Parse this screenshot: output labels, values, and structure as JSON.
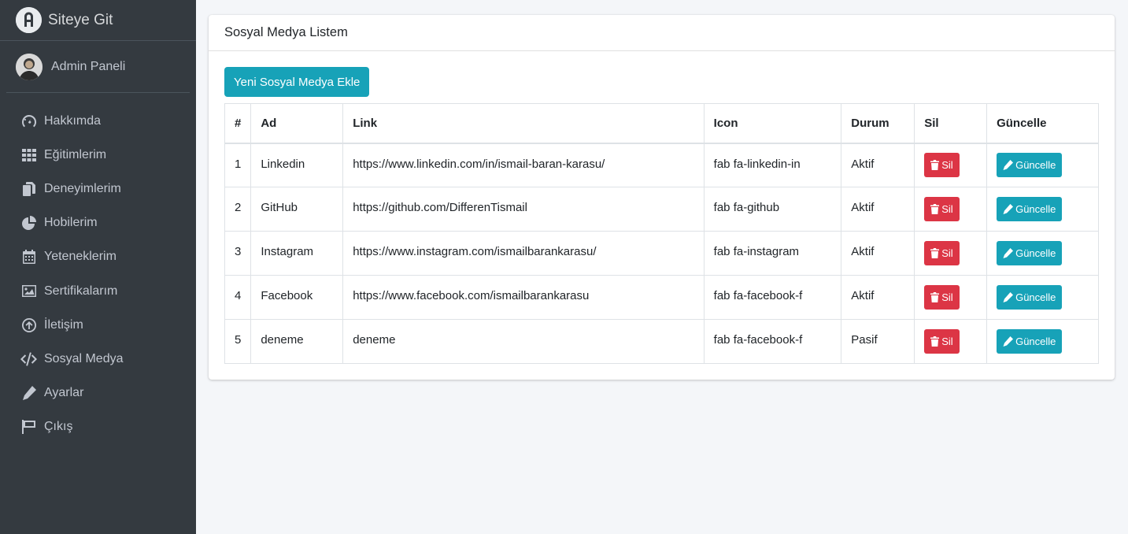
{
  "brand": {
    "title": "Siteye Git"
  },
  "user": {
    "name": "Admin Paneli"
  },
  "sidebar": {
    "items": [
      {
        "label": "Hakkımda",
        "icon": "tachometer-icon"
      },
      {
        "label": "Eğitimlerim",
        "icon": "grid-icon"
      },
      {
        "label": "Deneyimlerim",
        "icon": "copy-icon"
      },
      {
        "label": "Hobilerim",
        "icon": "pie-chart-icon"
      },
      {
        "label": "Yeteneklerim",
        "icon": "calendar-icon"
      },
      {
        "label": "Sertifikalarım",
        "icon": "image-icon"
      },
      {
        "label": "İletişim",
        "icon": "arrow-circle-up-icon"
      },
      {
        "label": "Sosyal Medya",
        "icon": "code-icon"
      },
      {
        "label": "Ayarlar",
        "icon": "pencil-icon"
      },
      {
        "label": "Çıkış",
        "icon": "flag-icon"
      }
    ]
  },
  "card": {
    "title": "Sosyal Medya Listem",
    "add_button": "Yeni Sosyal Medya Ekle"
  },
  "table": {
    "headers": [
      "#",
      "Ad",
      "Link",
      "Icon",
      "Durum",
      "Sil",
      "Güncelle"
    ],
    "delete_label": "Sil",
    "update_label": "Güncelle",
    "rows": [
      {
        "no": "1",
        "ad": "Linkedin",
        "link": "https://www.linkedin.com/in/ismail-baran-karasu/",
        "icon": "fab fa-linkedin-in",
        "durum": "Aktif"
      },
      {
        "no": "2",
        "ad": "GitHub",
        "link": "https://github.com/DifferenTismail",
        "icon": "fab fa-github",
        "durum": "Aktif"
      },
      {
        "no": "3",
        "ad": "Instagram",
        "link": "https://www.instagram.com/ismailbarankarasu/",
        "icon": "fab fa-instagram",
        "durum": "Aktif"
      },
      {
        "no": "4",
        "ad": "Facebook",
        "link": "https://www.facebook.com/ismailbarankarasu",
        "icon": "fab fa-facebook-f",
        "durum": "Aktif"
      },
      {
        "no": "5",
        "ad": "deneme",
        "link": "deneme",
        "icon": "fab fa-facebook-f",
        "durum": "Pasif"
      }
    ]
  },
  "colors": {
    "sidebar": "#343a40",
    "info": "#17a2b8",
    "danger": "#dc3545",
    "background": "#f4f6f9"
  }
}
